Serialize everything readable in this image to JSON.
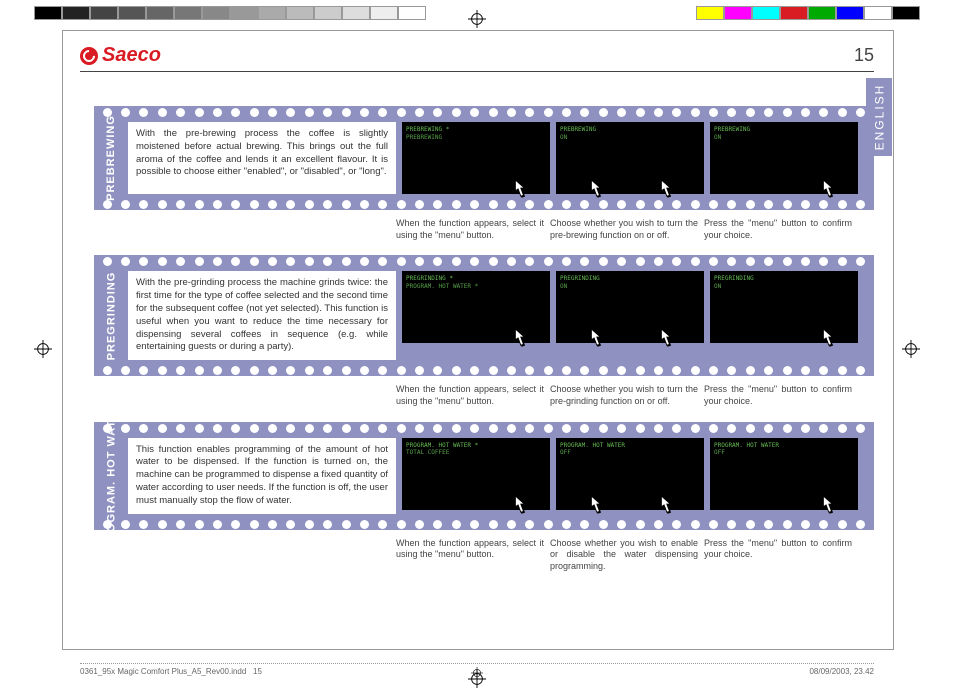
{
  "brand": "Saeco",
  "page_number": "15",
  "language_tab": "ENGLISH",
  "rows": [
    {
      "label": "PREBREWING",
      "description": "With the pre-brewing process the coffee is slightly moistened before actual brewing. This brings out the full aroma of the coffee and lends it an excellent flavour. It is possible to choose either \"enabled\", or \"disabled\", or \"long\".",
      "screens": [
        {
          "l1": "PREBREWING        *",
          "l2": "PREBREWING"
        },
        {
          "l1": "PREBREWING",
          "l2": "ON"
        },
        {
          "l1": "PREBREWING",
          "l2": "ON"
        }
      ],
      "captions": [
        "When the function appears, select it using the \"menu\" button.",
        "Choose whether you wish to turn the pre-brewing function on or off.",
        "Press the \"menu\" button to confirm your choice."
      ]
    },
    {
      "label": "PREGRINDING",
      "description": "With the pre-grinding process the machine grinds twice: the first time for the type of coffee selected and the second time for the subsequent coffee (not yet selected).\nThis function is useful when you want to reduce the time necessary for dispensing several coffees in sequence (e.g. while entertaining guests or during a party).",
      "screens": [
        {
          "l1": "PREGRINDING       *",
          "l2": "PROGRAM. HOT WATER *"
        },
        {
          "l1": "PREGRINDING",
          "l2": "ON"
        },
        {
          "l1": "PREGRINDING",
          "l2": "ON"
        }
      ],
      "captions": [
        "When the function appears, select it using the \"menu\" button.",
        "Choose whether you wish to turn the pre-grinding function on or off.",
        "Press the \"menu\" button to confirm your choice."
      ]
    },
    {
      "label": "PROGRAM. HOT WATER",
      "description": "This function enables programming of the amount of hot water to be dispensed. If the function is turned on, the machine can be programmed to dispense a fixed quantity of water according to user needs. If the function is off, the user must manually stop the flow of water.",
      "screens": [
        {
          "l1": "PROGRAM. HOT WATER *",
          "l2": "TOTAL COFFEE"
        },
        {
          "l1": "PROGRAM. HOT WATER",
          "l2": "OFF"
        },
        {
          "l1": "PROGRAM. HOT WATER",
          "l2": "OFF"
        }
      ],
      "captions": [
        "When the function appears, select it using the \"menu\" button.",
        "Choose whether you wish to enable or disable the water dispensing programming.",
        "Press the \"menu\" button to confirm your choice."
      ]
    }
  ],
  "footer": {
    "file": "0361_95x Magic Comfort Plus_A5_Rev00.indd",
    "page": "15",
    "date": "08/09/2003, 23.42"
  },
  "swatches_left": [
    "#000",
    "#222",
    "#444",
    "#555",
    "#666",
    "#777",
    "#888",
    "#999",
    "#aaa",
    "#bbb",
    "#ccc",
    "#ddd",
    "#eee",
    "#fff"
  ],
  "swatches_right": [
    "#ff0",
    "#f0f",
    "#0ff",
    "#d91c24",
    "#0a0",
    "#00f",
    "#fff",
    "#000"
  ]
}
